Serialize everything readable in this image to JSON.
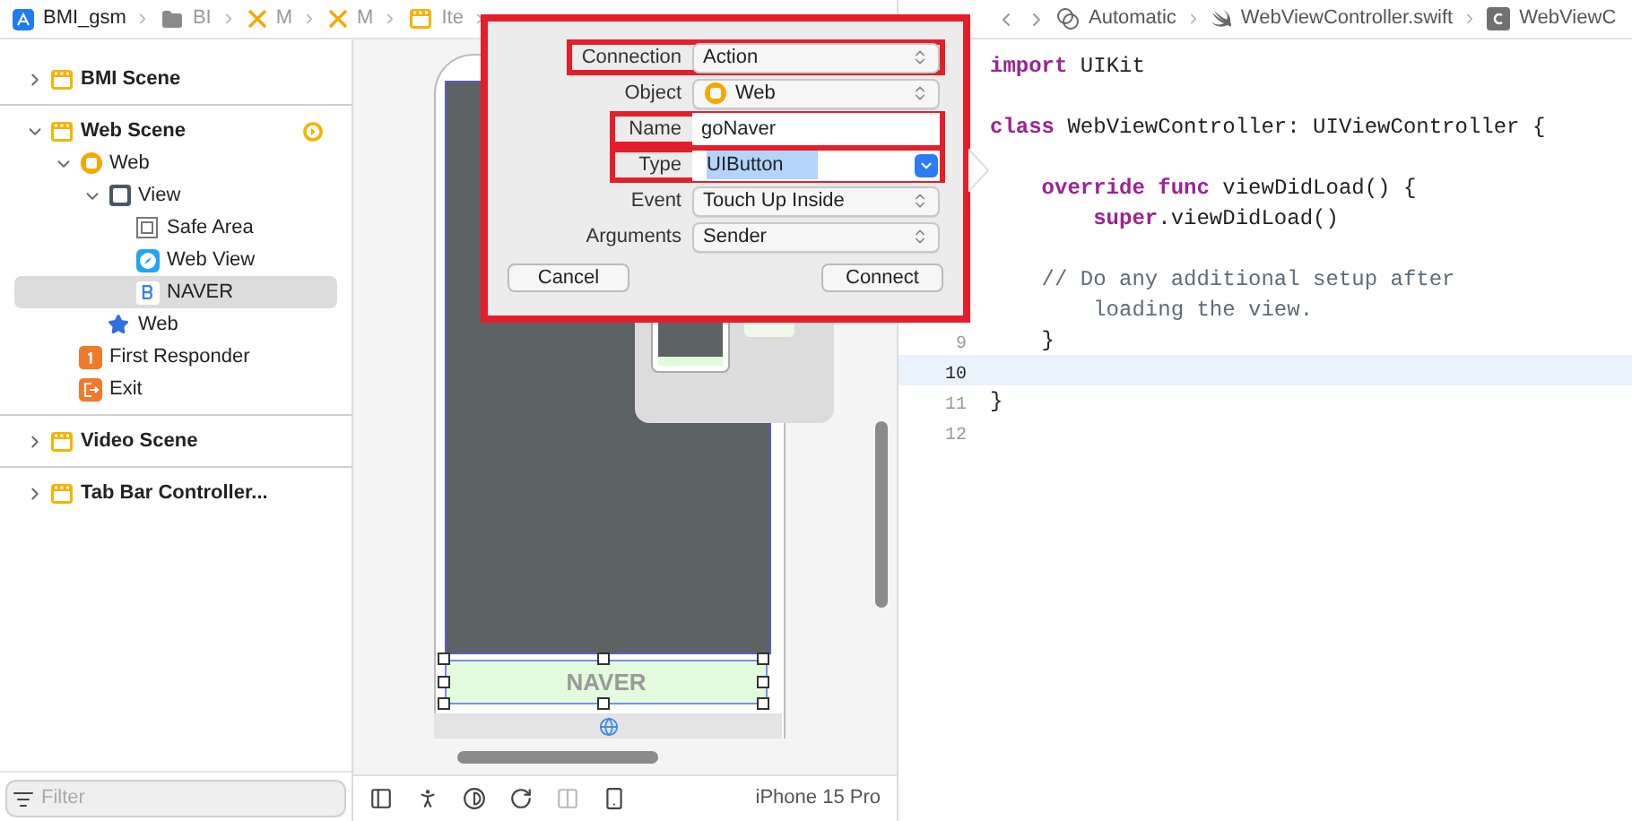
{
  "breadcrumbs": [
    {
      "kind": "project",
      "label": "BMI_gsm"
    },
    {
      "kind": "folder",
      "label": "BI"
    },
    {
      "kind": "storyboard",
      "label": "M"
    },
    {
      "kind": "storyboard",
      "label": "M"
    },
    {
      "kind": "scene",
      "label": "Ite"
    }
  ],
  "editor_jump_bar": [
    {
      "kind": "automatic",
      "label": "Automatic"
    },
    {
      "kind": "swift",
      "label": "WebViewController.swift"
    },
    {
      "kind": "class",
      "label": "WebViewC"
    }
  ],
  "navigator": {
    "scenes": [
      {
        "label": "BMI Scene",
        "expanded": false,
        "entry_point": false
      },
      {
        "label": "Web Scene",
        "expanded": true,
        "entry_point": true,
        "children": [
          {
            "kind": "controller",
            "label": "Web",
            "expanded": true,
            "selected": false,
            "children": [
              {
                "kind": "view",
                "label": "View",
                "expanded": true,
                "selected": false,
                "children": [
                  {
                    "kind": "safe-area",
                    "label": "Safe Area",
                    "selected": false
                  },
                  {
                    "kind": "webview",
                    "label": "Web View",
                    "selected": false
                  },
                  {
                    "kind": "button",
                    "label": "NAVER",
                    "selected": true
                  }
                ]
              },
              {
                "kind": "navitem",
                "label": "Web",
                "selected": false
              }
            ]
          },
          {
            "kind": "responder",
            "label": "First Responder",
            "selected": false
          },
          {
            "kind": "exit",
            "label": "Exit",
            "selected": false
          }
        ]
      },
      {
        "label": "Video Scene",
        "expanded": false,
        "entry_point": false
      },
      {
        "label": "Tab Bar Controller...",
        "expanded": false,
        "entry_point": false
      }
    ],
    "filter": {
      "placeholder": "Filter"
    }
  },
  "connection_popup": {
    "rows": [
      {
        "label": "Connection",
        "kind": "popup",
        "value": "Action",
        "highlighted": true
      },
      {
        "label": "Object",
        "kind": "object-popup",
        "value": "Web",
        "highlighted": false
      },
      {
        "label": "Name",
        "kind": "field",
        "value": "goNaver",
        "highlighted": true
      },
      {
        "label": "Type",
        "kind": "combo",
        "value": "UIButton",
        "highlighted": true
      },
      {
        "label": "Event",
        "kind": "popup",
        "value": "Touch Up Inside",
        "highlighted": false
      },
      {
        "label": "Arguments",
        "kind": "popup",
        "value": "Sender",
        "highlighted": false
      }
    ],
    "buttons": [
      "Cancel",
      "Connect"
    ]
  },
  "canvas": {
    "button_title": "NAVER",
    "device": "iPhone 15 Pro"
  },
  "code": [
    {
      "kind": "code",
      "segments": [
        {
          "kind": "keyword",
          "text": "import"
        },
        {
          "kind": "plain",
          "text": " UIKit"
        }
      ]
    },
    {
      "kind": "blank"
    },
    {
      "kind": "code",
      "segments": [
        {
          "kind": "keyword",
          "text": "class"
        },
        {
          "kind": "plain",
          "text": " WebViewController: UIViewController {"
        }
      ]
    },
    {
      "kind": "blank"
    },
    {
      "kind": "code",
      "segments": [
        {
          "kind": "keyword",
          "text": "    override"
        },
        {
          "kind": "keyword",
          "text": " func"
        },
        {
          "kind": "plain",
          "text": " viewDidLoad() {"
        }
      ]
    },
    {
      "kind": "code",
      "segments": [
        {
          "kind": "keyword",
          "text": "        super"
        },
        {
          "kind": "plain",
          "text": ".viewDidLoad()"
        }
      ]
    },
    {
      "kind": "blank"
    },
    {
      "kind": "code",
      "segments": [
        {
          "kind": "comment",
          "text": "    // Do any additional setup after"
        }
      ]
    },
    {
      "kind": "code",
      "segments": [
        {
          "kind": "comment",
          "text": "        loading the view."
        }
      ]
    },
    {
      "kind": "code",
      "number": "9",
      "current": false,
      "segments": [
        {
          "kind": "plain",
          "text": "    }"
        }
      ]
    },
    {
      "kind": "blank",
      "number": "10",
      "current": true
    },
    {
      "kind": "code",
      "number": "11",
      "current": false,
      "segments": [
        {
          "kind": "plain",
          "text": "}"
        }
      ]
    },
    {
      "kind": "blank",
      "number": "12",
      "current": false
    }
  ]
}
